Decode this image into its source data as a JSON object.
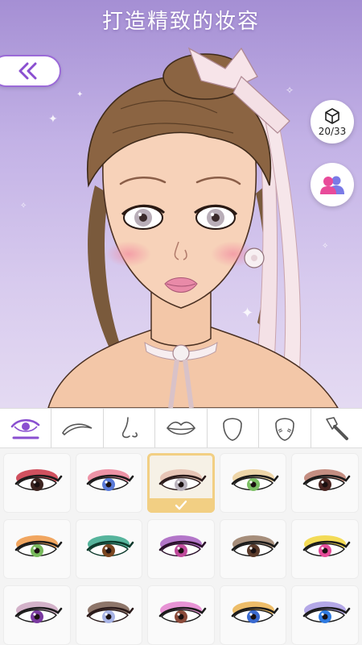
{
  "header": {
    "title": "打造精致的妆容"
  },
  "counter": {
    "text": "20/33"
  },
  "colors": {
    "accent": "#9b6ad8",
    "selected": "#f2cf83",
    "social": "#e84b9a"
  },
  "tabs": [
    {
      "icon": "eye-icon",
      "active": true
    },
    {
      "icon": "eyebrow-icon",
      "active": false
    },
    {
      "icon": "nose-icon",
      "active": false
    },
    {
      "icon": "lips-icon",
      "active": false
    },
    {
      "icon": "face-shape-icon",
      "active": false
    },
    {
      "icon": "blush-face-icon",
      "active": false
    },
    {
      "icon": "makeup-brush-icon",
      "active": false
    }
  ],
  "eye_styles": [
    {
      "shadow": "#c2182b",
      "iris": "#3c2420",
      "liner": "#1a1a1a",
      "selected": false
    },
    {
      "shadow": "#e8708a",
      "iris": "#5a7ad8",
      "liner": "#1a1a1a",
      "selected": false
    },
    {
      "shadow": "#e2b6a6",
      "iris": "#b9b2bc",
      "liner": "#2a1a1a",
      "selected": true
    },
    {
      "shadow": "#e9c98e",
      "iris": "#7cc064",
      "liner": "#1a1a1a",
      "selected": false
    },
    {
      "shadow": "#b26a5a",
      "iris": "#4a2622",
      "liner": "#1a1a1a",
      "selected": false
    },
    {
      "shadow": "#ee8a2c",
      "iris": "#78b95c",
      "liner": "#1a1a1a",
      "selected": false
    },
    {
      "shadow": "#1f9c7c",
      "iris": "#7a4620",
      "liner": "#0d3a2c",
      "selected": false
    },
    {
      "shadow": "#9b4ab8",
      "iris": "#c04a9c",
      "liner": "#2a0f2a",
      "selected": false
    },
    {
      "shadow": "#8a6a50",
      "iris": "#5a3a2a",
      "liner": "#1a1a1a",
      "selected": false
    },
    {
      "shadow": "#f0d020",
      "iris": "#e54c9a",
      "liner": "#1a1a1a",
      "selected": false
    },
    {
      "shadow": "#c69ab8",
      "iris": "#7a3aa0",
      "liner": "#1a1a1a",
      "selected": false
    },
    {
      "shadow": "#6a4a3a",
      "iris": "#a8b4e6",
      "liner": "#2a1a1a",
      "selected": false
    },
    {
      "shadow": "#e070c8",
      "iris": "#8a4a3a",
      "liner": "#1a1a1a",
      "selected": false
    },
    {
      "shadow": "#e8a838",
      "iris": "#3a6ad0",
      "liner": "#1a1a1a",
      "selected": false
    },
    {
      "shadow": "#9c8ce0",
      "iris": "#2f7ae0",
      "liner": "#1a1a1a",
      "selected": false
    }
  ]
}
